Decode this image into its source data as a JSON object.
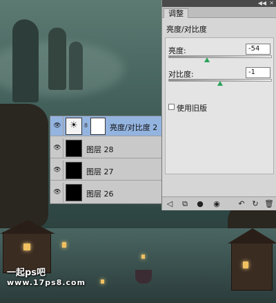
{
  "adjustments_panel": {
    "tab_label": "调整",
    "title": "亮度/对比度",
    "brightness": {
      "label": "亮度:",
      "value": "-54",
      "level": 0.37
    },
    "contrast": {
      "label": "对比度:",
      "value": "-1",
      "level": 0.5
    },
    "use_legacy_label": "使用旧版",
    "use_legacy_checked": false,
    "bottom_icons": [
      "back-icon",
      "clip-icon",
      "visibility-icon",
      "eye-icon",
      "previous-state-icon",
      "reset-icon",
      "delete-icon"
    ]
  },
  "layers_panel": {
    "layers": [
      {
        "name": "亮度/对比度 2",
        "type": "adjustment",
        "selected": true
      },
      {
        "name": "图层 28",
        "type": "pixel",
        "selected": false
      },
      {
        "name": "图层 27",
        "type": "pixel",
        "selected": false
      },
      {
        "name": "图层 26",
        "type": "pixel",
        "selected": false
      }
    ]
  },
  "watermark": {
    "line1": "一起ps吧",
    "line2": "www.17ps8.com"
  }
}
